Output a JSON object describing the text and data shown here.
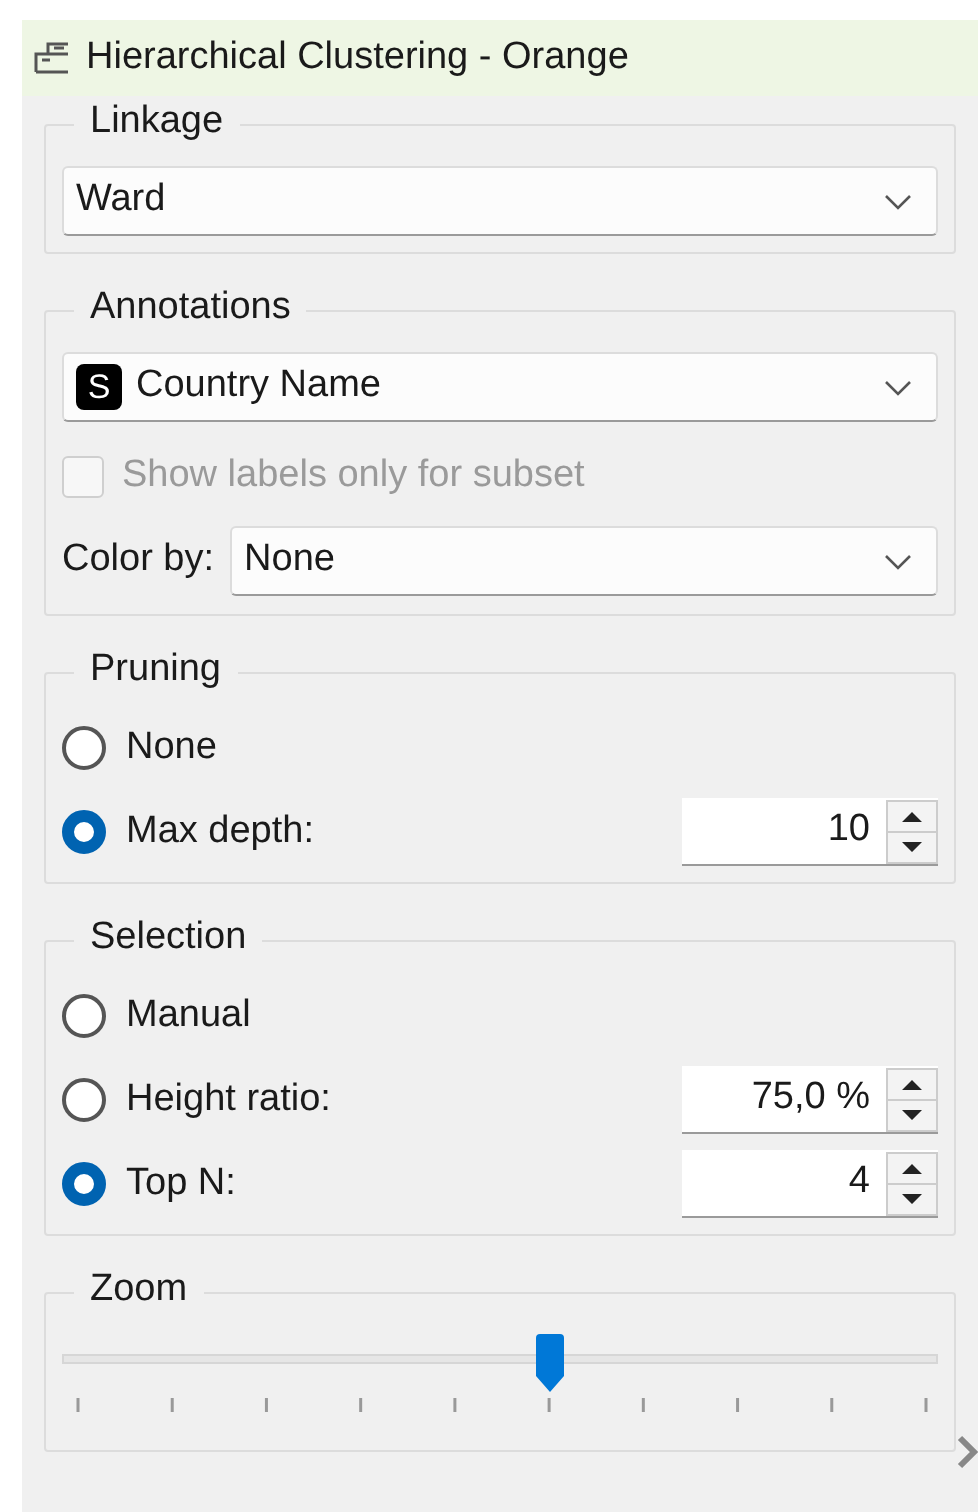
{
  "window": {
    "title": "Hierarchical Clustering - Orange"
  },
  "linkage": {
    "title": "Linkage",
    "value": "Ward"
  },
  "annotations": {
    "title": "Annotations",
    "type_badge": "S",
    "value": "Country Name",
    "subset_checkbox": {
      "label": "Show labels only for subset",
      "checked": false,
      "disabled": true
    },
    "color_by": {
      "label": "Color by:",
      "value": "None"
    }
  },
  "pruning": {
    "title": "Pruning",
    "options": [
      {
        "label": "None",
        "selected": false
      },
      {
        "label": "Max depth:",
        "selected": true,
        "spin_value": "10"
      }
    ]
  },
  "selection": {
    "title": "Selection",
    "options": [
      {
        "label": "Manual",
        "selected": false
      },
      {
        "label": "Height ratio:",
        "selected": false,
        "spin_value": "75,0 %"
      },
      {
        "label": "Top N:",
        "selected": true,
        "spin_value": "4"
      }
    ]
  },
  "zoom": {
    "title": "Zoom",
    "level": 0.556
  }
}
